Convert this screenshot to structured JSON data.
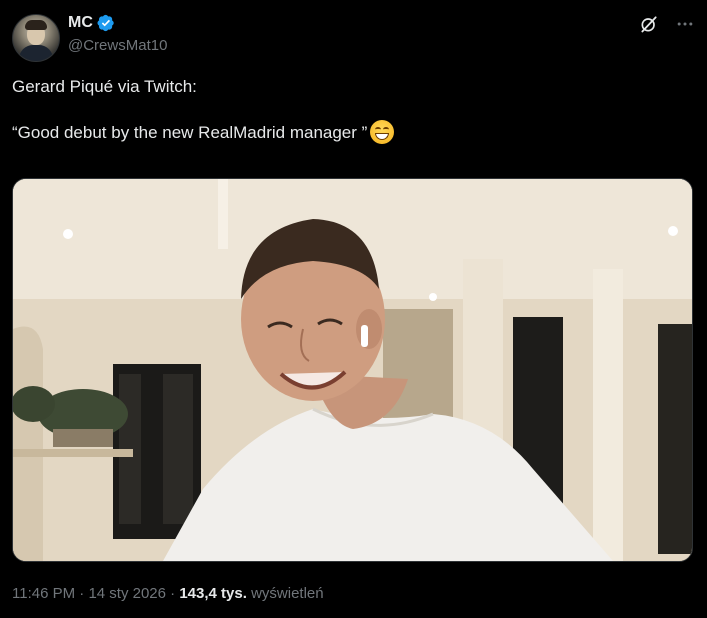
{
  "author": {
    "name": "MC",
    "handle": "@CrewsMat10",
    "verified": true,
    "accent_color": "#1d9bf0"
  },
  "header_actions": [
    {
      "icon": "grok-icon"
    },
    {
      "icon": "more-icon"
    }
  ],
  "tweet": {
    "line1": "Gerard Piqué via Twitch:",
    "line2": "“Good debut by the new RealMadrid manager ”",
    "emoji": "grinning-face-with-smiling-eyes"
  },
  "media": {
    "type": "photo"
  },
  "footer": {
    "time": "11:46 PM",
    "sep1": "·",
    "date": "14 sty 2026",
    "sep2": "·",
    "views_count": "143,4 tys.",
    "views_label": "wyświetleń"
  }
}
